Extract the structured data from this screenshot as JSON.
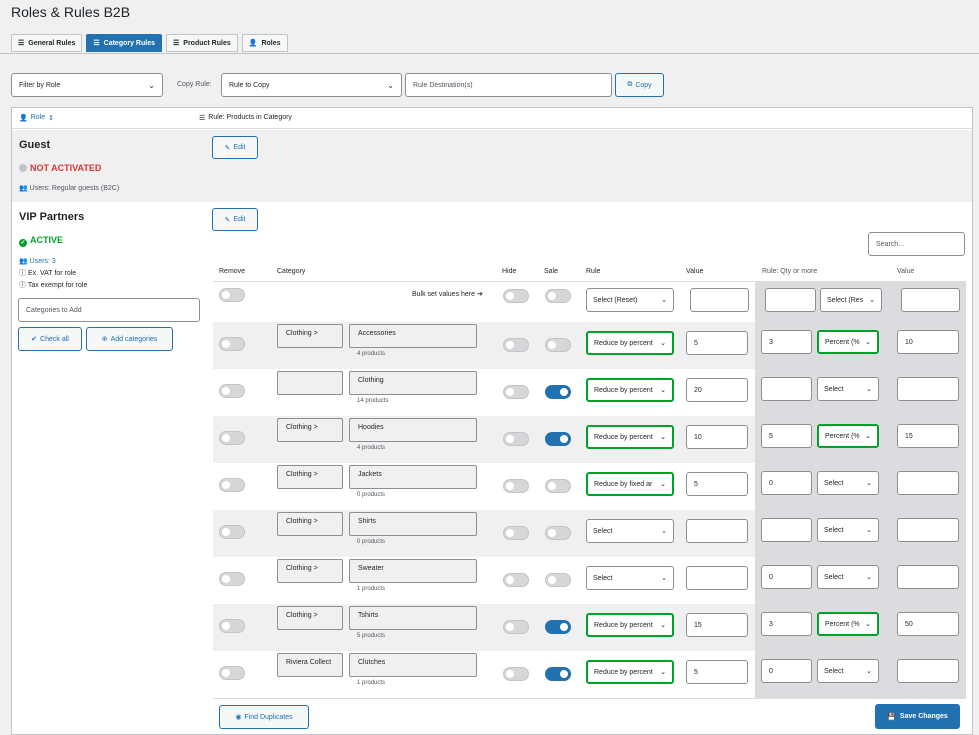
{
  "title": "Roles & Rules B2B",
  "tabs": [
    {
      "label": "General Rules",
      "icon": "sliders-icon",
      "active": false
    },
    {
      "label": "Category Rules",
      "icon": "sliders-icon",
      "active": true
    },
    {
      "label": "Product Rules",
      "icon": "sliders-icon",
      "active": false
    },
    {
      "label": "Roles",
      "icon": "users-icon",
      "active": false
    }
  ],
  "filters": {
    "filter_by_role": "Filter by Role",
    "copy_rule_label": "Copy Rule:",
    "rule_to_copy": "Rule to Copy",
    "rule_destination_placeholder": "Rule Destination(s)",
    "copy_button": "Copy"
  },
  "header": {
    "role_col": "Role",
    "rule_col": "Rule: Products in Category"
  },
  "guest": {
    "name": "Guest",
    "status": "NOT ACTIVATED",
    "users": "Users: Regular guests (B2C)",
    "edit": "Edit"
  },
  "vip": {
    "name": "VIP Partners",
    "status": "ACTIVE",
    "users": "Users: 3",
    "vat": "Ex. VAT for role",
    "tax": "Tax exempt for role",
    "categories_placeholder": "Categories to Add",
    "check_all": "Check all",
    "add_categories": "Add categories",
    "edit": "Edit",
    "search_placeholder": "Search..."
  },
  "columns": {
    "remove": "Remove",
    "category": "Category",
    "hide": "Hide",
    "sale": "Sale",
    "rule": "Rule",
    "value": "Value",
    "qty_rule": "Rule: Qty or more",
    "value2": "Value"
  },
  "bulk": {
    "label": "Bulk set values here",
    "rule": "Select (Reset)",
    "qty_type": "Select (Res"
  },
  "rows": [
    {
      "parent": "Clothing >",
      "name": "Accessories",
      "count": "4 products",
      "sale": false,
      "rule": "Reduce by percent",
      "rule_set": true,
      "value": "5",
      "qty": "3",
      "qty_type": "Percent (%",
      "qty_set": true,
      "value2": "10"
    },
    {
      "parent": "",
      "name": "Clothing",
      "count": "14 products",
      "sale": true,
      "rule": "Reduce by percent",
      "rule_set": true,
      "value": "20",
      "qty": "",
      "qty_type": "Select",
      "qty_set": false,
      "value2": ""
    },
    {
      "parent": "Clothing >",
      "name": "Hoodies",
      "count": "4 products",
      "sale": true,
      "rule": "Reduce by percent",
      "rule_set": true,
      "value": "10",
      "qty": "5",
      "qty_type": "Percent (%",
      "qty_set": true,
      "value2": "15"
    },
    {
      "parent": "Clothing >",
      "name": "Jackets",
      "count": "0 products",
      "sale": false,
      "rule": "Reduce by fixed ar",
      "rule_set": true,
      "value": "5",
      "qty": "0",
      "qty_type": "Select",
      "qty_set": false,
      "value2": ""
    },
    {
      "parent": "Clothing >",
      "name": "Shirts",
      "count": "0 products",
      "sale": false,
      "rule": "Select",
      "rule_set": false,
      "value": "",
      "qty": "",
      "qty_type": "Select",
      "qty_set": false,
      "value2": ""
    },
    {
      "parent": "Clothing >",
      "name": "Sweater",
      "count": "1 products",
      "sale": false,
      "rule": "Select",
      "rule_set": false,
      "value": "",
      "qty": "0",
      "qty_type": "Select",
      "qty_set": false,
      "value2": ""
    },
    {
      "parent": "Clothing >",
      "name": "Tshirts",
      "count": "5 products",
      "sale": true,
      "rule": "Reduce by percent",
      "rule_set": true,
      "value": "15",
      "qty": "3",
      "qty_type": "Percent (%",
      "qty_set": true,
      "value2": "50"
    },
    {
      "parent": "Riviera Collect",
      "name": "Clutches",
      "count": "1 products",
      "sale": true,
      "rule": "Reduce by percent",
      "rule_set": true,
      "value": "5",
      "qty": "0",
      "qty_type": "Select",
      "qty_set": false,
      "value2": ""
    }
  ],
  "footer": {
    "find_duplicates": "Find Duplicates",
    "save": "Save Changes"
  },
  "colors": {
    "accent": "#2271b1",
    "active": "#00a32a",
    "inactive": "#d63638"
  }
}
